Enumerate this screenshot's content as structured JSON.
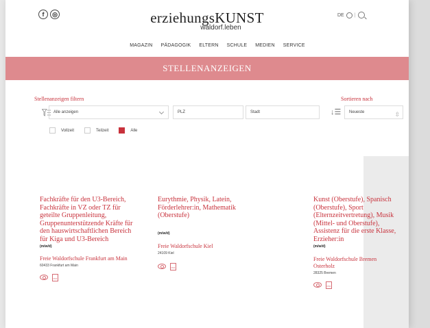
{
  "header": {
    "social": [
      "f",
      "◎"
    ],
    "logo_main": "erziehungsKUNST",
    "logo_sub": "waldorf.leben",
    "lang": "DE"
  },
  "nav": [
    "MAGAZIN",
    "PÄDAGOGIK",
    "ELTERN",
    "SCHULE",
    "MEDIEN",
    "SERVICE"
  ],
  "banner": "STELLENANZEIGEN",
  "filter": {
    "label": "Stellenanzeigen filtern",
    "select_value": "Alle anzeigen",
    "plz_placeholder": "PLZ",
    "stadt_placeholder": "Stadt",
    "sort_label": "Sortieren nach",
    "sort_value": "Neueste",
    "checkboxes": [
      {
        "label": "Vollzeit",
        "checked": false
      },
      {
        "label": "Teilzeit",
        "checked": false
      },
      {
        "label": "Alle",
        "checked": true
      }
    ]
  },
  "cards": [
    {
      "title": "Fachkräfte für den U3-Bereich, Fachkräfte in VZ oder TZ für geteilte Gruppenleitung, Gruppenunterstützende Kräfte für den hauswirtschaftlichen Bereich für Kiga und U3-Bereich",
      "mwd": "(m/w/d)",
      "school": "Freie Waldorfschule Frankfurt am Main",
      "city": "60433 Frankfurt am Main",
      "pdf": "PDF"
    },
    {
      "title": "Eurythmie, Physik, Latein, Förderlehrer:in, Mathematik (Oberstufe)",
      "mwd": "(m/w/d)",
      "school": "Freie Waldorfschule Kiel",
      "city": "24109 Kiel",
      "pdf": "PDF"
    },
    {
      "title": "Kunst (Oberstufe), Spanisch (Oberstufe), Sport (Elternzeitvertretung), Musik (Mittel- und Oberstufe), Assistenz für die erste Klasse, Erzieher:in",
      "mwd": "(m/w/d)",
      "school": "Freie Waldorfschule Bremen Osterholz",
      "city": "28325 Bremen",
      "pdf": "PDF"
    }
  ],
  "colors": {
    "accent": "#c8323c",
    "banner": "#de8a8e"
  }
}
